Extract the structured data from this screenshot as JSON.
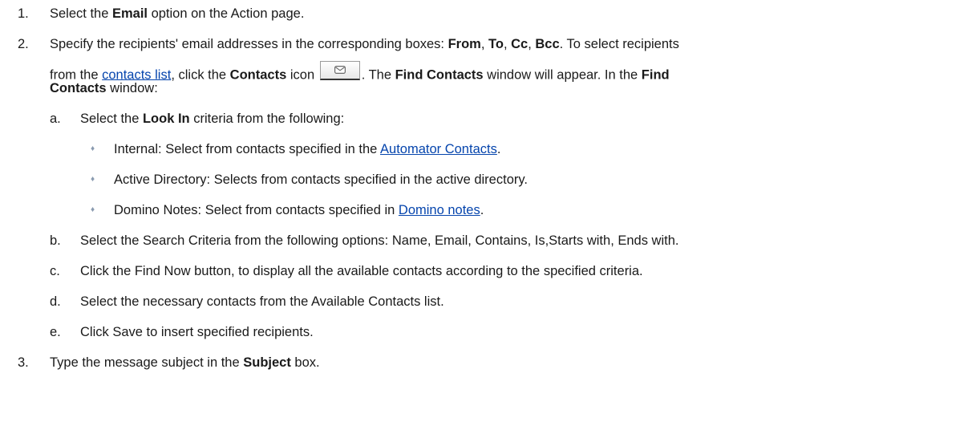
{
  "steps": [
    {
      "num": "1.",
      "parts": [
        "Select the ",
        "Email",
        " option on the Action page."
      ]
    },
    {
      "num": "2.",
      "line1": [
        "Specify the recipients' email addresses in the corresponding boxes: ",
        "From",
        ", ",
        "To",
        ", ",
        "Cc",
        ", ",
        "Bcc",
        ". To select recipients"
      ],
      "line2_a": "from the ",
      "line2_link": "contacts list",
      "line2_b": ", click the ",
      "line2_c": "Contacts",
      "line2_d": " icon ",
      "line2_e": ". The ",
      "line2_f": "Find Contacts",
      "line2_g": " window will appear. In the ",
      "line2_h": "Find",
      "line3_a": "Contacts",
      "line3_b": " window:",
      "contacts_icon": "envelope-icon",
      "substeps": [
        {
          "letter": "a.",
          "parts": [
            "Select the ",
            "Look In",
            " criteria from the following:"
          ]
        },
        {
          "letter": "b.",
          "text": "Select the Search Criteria from the following options: Name, Email, Contains, Is,Starts with, Ends with."
        },
        {
          "letter": "c.",
          "text": "Click the Find Now button, to display all the available contacts according to the specified criteria."
        },
        {
          "letter": "d.",
          "text": "Select the necessary contacts from the Available Contacts list."
        },
        {
          "letter": "e.",
          "text": "Click Save to insert specified recipients."
        }
      ],
      "bullets": [
        {
          "pre": "Internal:  Select from contacts specified in the ",
          "link": "Automator Contacts",
          "post": "."
        },
        {
          "pre": "Active Directory: Selects from contacts specified in the active directory.",
          "link": "",
          "post": ""
        },
        {
          "pre": "Domino Notes: Select from contacts specified in ",
          "link": "Domino notes",
          "post": "."
        }
      ]
    },
    {
      "num": "3.",
      "parts": [
        "Type the message subject in the ",
        "Subject",
        " box."
      ]
    }
  ],
  "bullet_glyph": "♦"
}
